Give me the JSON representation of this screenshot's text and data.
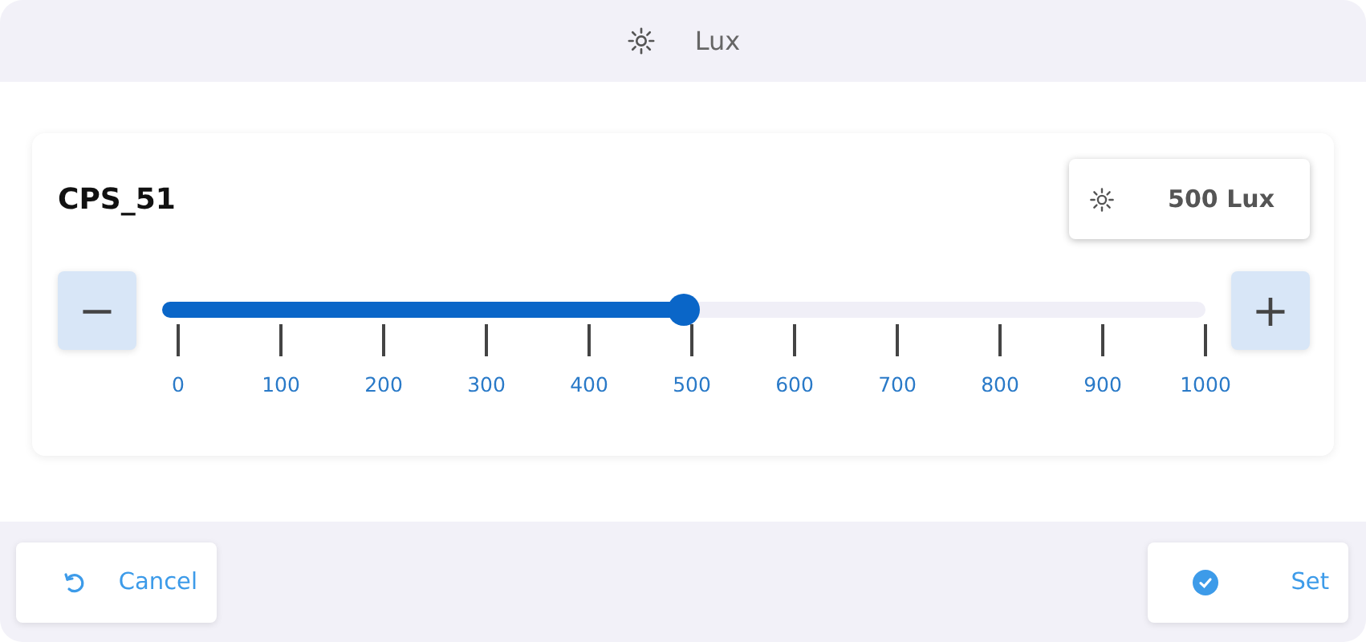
{
  "header": {
    "title": "Lux"
  },
  "card": {
    "title": "CPS_51",
    "readout": "500 Lux",
    "slider": {
      "level": 0.5,
      "minus": "−",
      "plus": "+",
      "ticks": [
        "0",
        "100",
        "200",
        "300",
        "400",
        "500",
        "600",
        "700",
        "800",
        "900",
        "1000"
      ]
    }
  },
  "buttons": [
    {
      "kind": "cancel",
      "label": "Cancel"
    },
    {
      "kind": "set",
      "label": "Set"
    }
  ]
}
